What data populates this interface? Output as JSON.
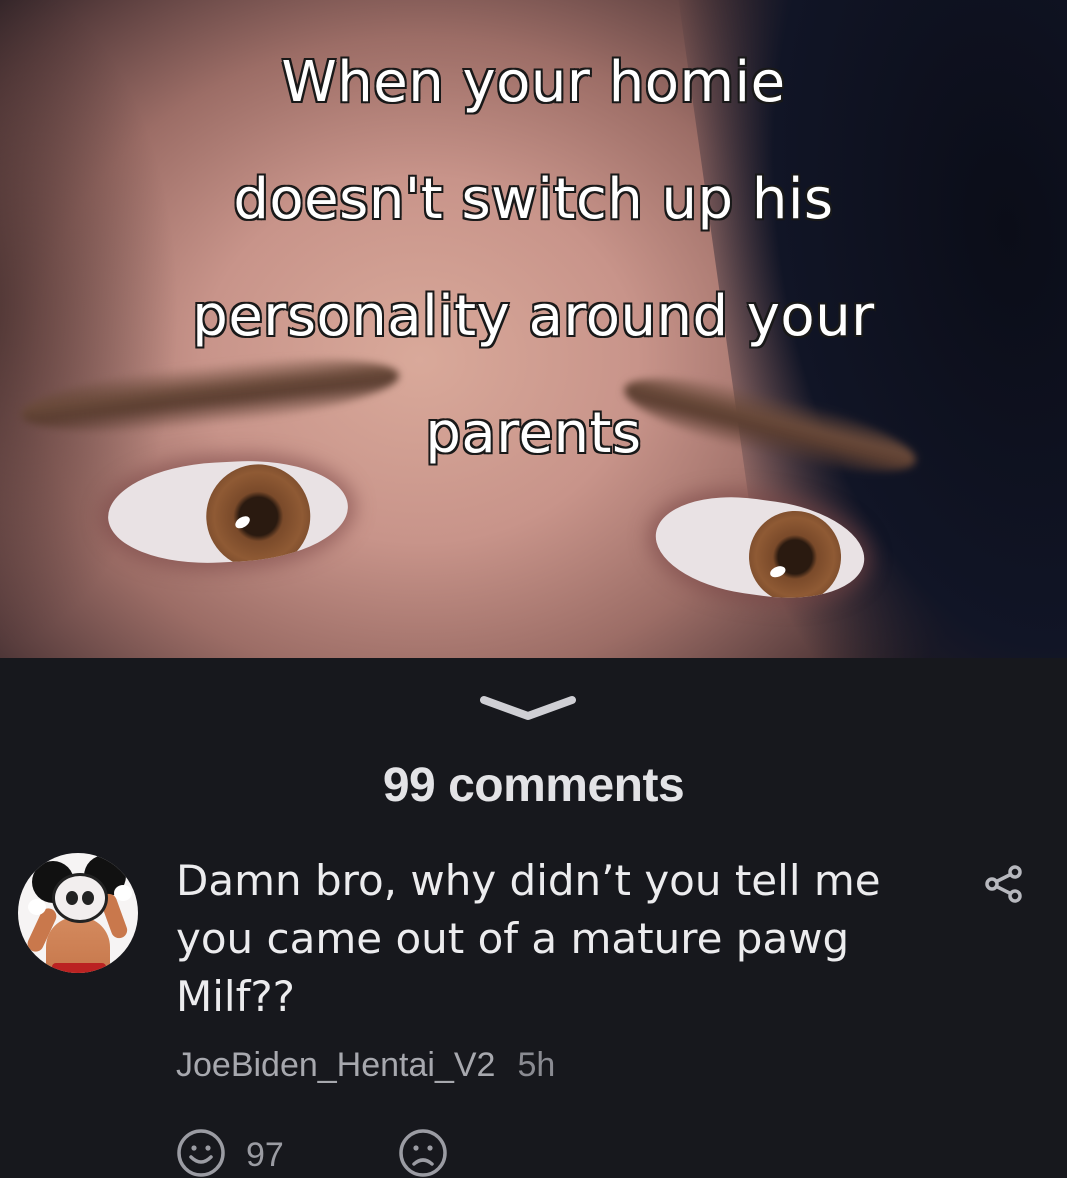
{
  "post": {
    "caption_lines": [
      "When your homie",
      "doesn't switch up his",
      "personality around your",
      "parents"
    ]
  },
  "comments_header": {
    "count_label": "99 comments",
    "collapse_icon": "chevron-down-icon"
  },
  "comment": {
    "text": "Damn bro, why didn’t you tell me you came out of a mature pawg Milf??",
    "username": "JoeBiden_Hentai_V2",
    "age": "5h",
    "like_count": "97",
    "icons": {
      "share": "share-icon",
      "like": "smile-icon",
      "dislike": "frown-icon"
    }
  },
  "colors": {
    "background": "#17181d",
    "text_primary": "#ececee",
    "text_secondary": "#9b9ca3"
  }
}
